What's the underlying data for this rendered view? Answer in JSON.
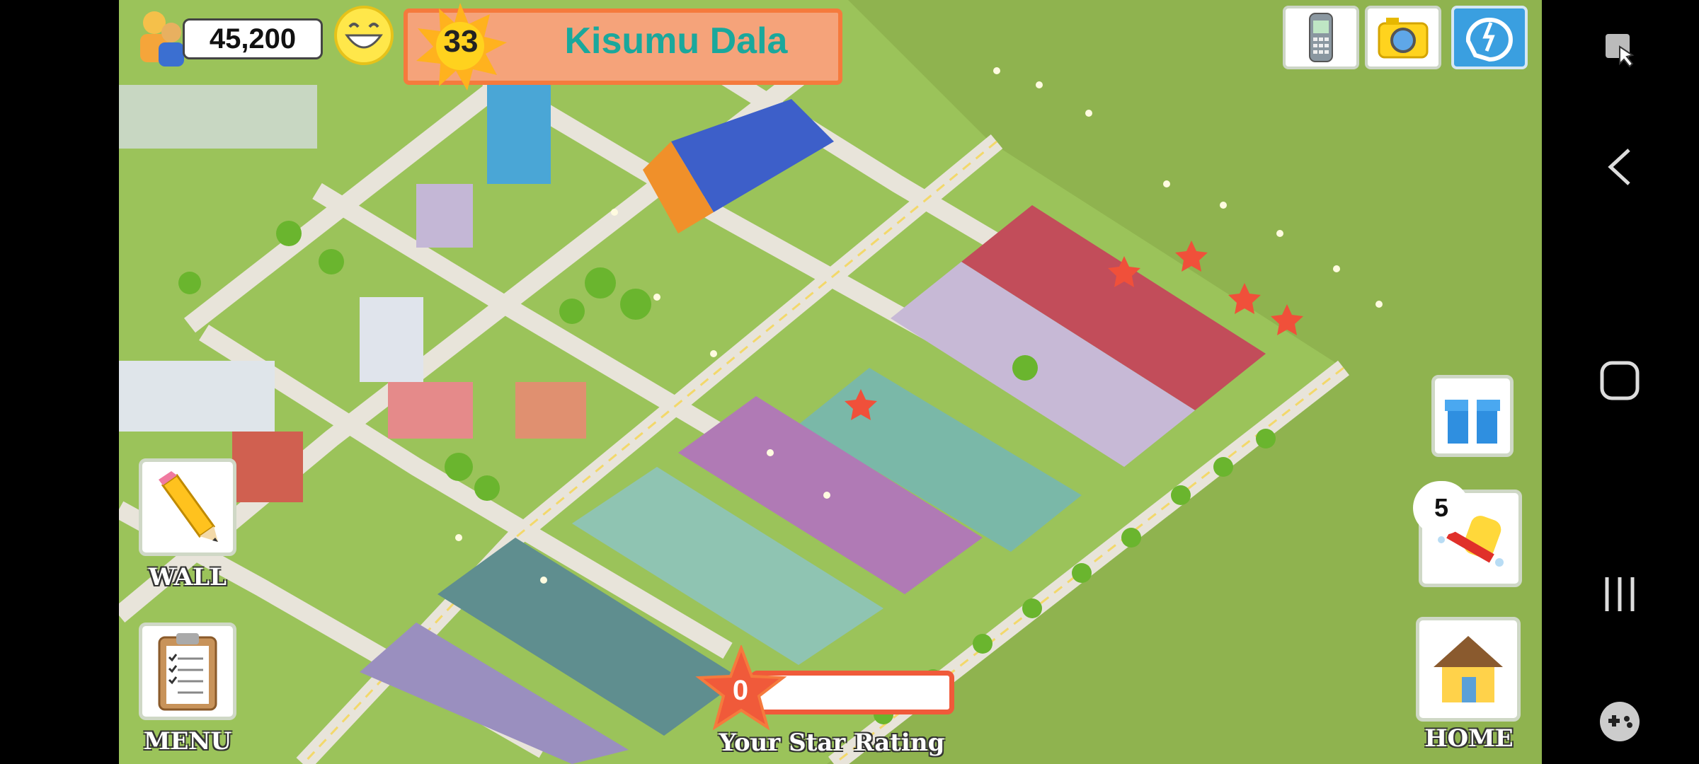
{
  "hud": {
    "population": "45,200",
    "level": "33",
    "city_name": "Kisumu Dala"
  },
  "top_buttons": [
    {
      "icon": "phone-icon"
    },
    {
      "icon": "camera-icon"
    },
    {
      "icon": "share-icon"
    }
  ],
  "left_buttons": {
    "wall_label": "WALL",
    "menu_label": "MENU"
  },
  "right_buttons": {
    "gift_icon": "gift-icon",
    "cleanup_count": "5",
    "home_label": "HOME"
  },
  "star_rating": {
    "value": "0",
    "label": "Your Star Rating",
    "progress_fraction": 0
  },
  "colors": {
    "grass": "#8fb34f",
    "banner_fill": "#f5a37a",
    "banner_border": "#f57a3d",
    "city_name": "#1aa89c",
    "star_red": "#f05a3a"
  }
}
